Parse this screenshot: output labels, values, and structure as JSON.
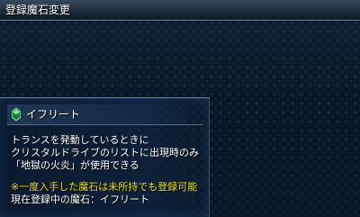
{
  "header": {
    "title": "登録魔石変更"
  },
  "selected_stone": {
    "icon": "green-magicite-icon",
    "name": "イフリート"
  },
  "description": {
    "lines": [
      "トランスを発動しているときに",
      "クリスタルドライブのリストに出現時のみ",
      "「地獄の火炎」が使用できる"
    ]
  },
  "note": "※一度入手した魔石は未所持でも登録可能",
  "current_registration": "現在登録中の魔石：イフリート",
  "colors": {
    "note_text": "#f0e000",
    "body_text": "#ffffff",
    "panel_border": "#6c86a8",
    "magicite_green": "#2fbf5a"
  }
}
